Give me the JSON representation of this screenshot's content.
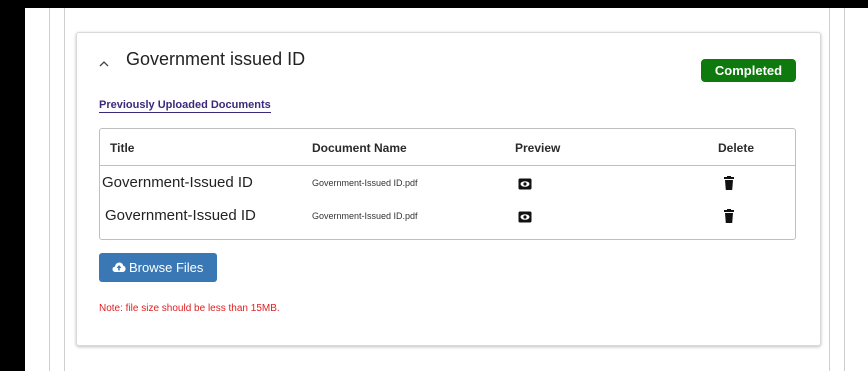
{
  "section": {
    "title": "Government issued ID",
    "status": "Completed",
    "status_color": "#0e7a0e",
    "previous_link": "Previously Uploaded Documents"
  },
  "table": {
    "headers": {
      "title": "Title",
      "document_name": "Document Name",
      "preview": "Preview",
      "delete": "Delete"
    },
    "rows": [
      {
        "title": "Government-Issued ID",
        "document_name": "Government-Issued ID.pdf",
        "preview_icon": "eye-icon",
        "delete_icon": "trash-icon"
      },
      {
        "title": "Government-Issued ID",
        "document_name": "Government-Issued ID.pdf",
        "preview_icon": "eye-icon",
        "delete_icon": "trash-icon"
      }
    ]
  },
  "browse": {
    "label": "Browse Files",
    "icon": "cloud-upload-icon",
    "color": "#3a78b5"
  },
  "note": {
    "text": "Note: file size should be less than 15MB.",
    "color": "#e02020"
  }
}
